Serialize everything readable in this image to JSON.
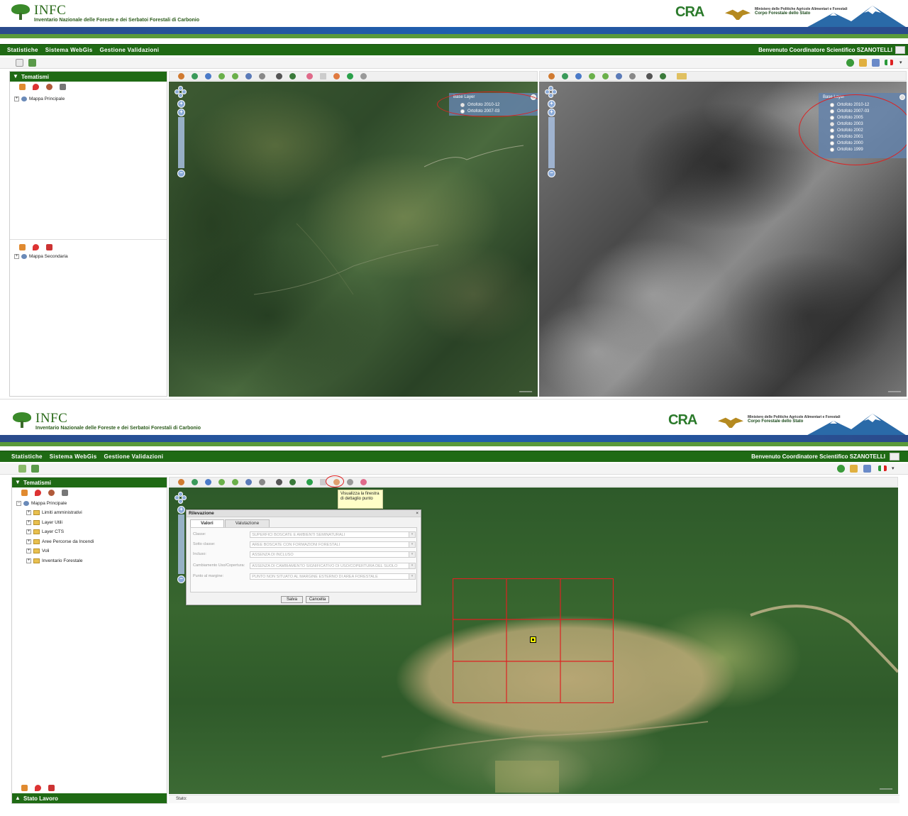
{
  "app": {
    "logo_title": "INFC",
    "logo_subtitle": "Inventario Nazionale delle Foreste e dei Serbatoi Forestali di Carbonio",
    "cra_logo": "CRA",
    "ministry_line": "Ministero delle Politiche Agricole Alimentari e Forestali",
    "corpo_line": "Corpo Forestale dello Stato"
  },
  "menu": {
    "items": [
      "Statistiche",
      "Sistema WebGis",
      "Gestione Validazioni"
    ],
    "welcome": "Benvenuto Coordinatore Scientifico SZANOTELLI"
  },
  "screen1": {
    "panel_title": "Tematismi",
    "main_map_label": "Mappa Principale",
    "secondary_map_label": "Mappa Secondaria",
    "left_map": {
      "base_layer_title": "Base Layer",
      "options": [
        {
          "label": "Ortofoto 2010-12",
          "selected": true
        },
        {
          "label": "Ortofoto 2007-03",
          "selected": false
        }
      ]
    },
    "right_map": {
      "base_layer_title": "Base Layer",
      "options": [
        {
          "label": "Ortofoto 2010-12",
          "selected": false
        },
        {
          "label": "Ortofoto 2007-03",
          "selected": false
        },
        {
          "label": "Ortofoto 2005",
          "selected": false
        },
        {
          "label": "Ortofoto 2003",
          "selected": true
        },
        {
          "label": "Ortofoto 2002",
          "selected": false
        },
        {
          "label": "Ortofoto 2001",
          "selected": false
        },
        {
          "label": "Ortofoto 2000",
          "selected": false
        },
        {
          "label": "Ortofoto 1999",
          "selected": false
        }
      ]
    }
  },
  "screen2": {
    "panel_title": "Tematismi",
    "main_map_label": "Mappa Principale",
    "tree_items": [
      "Limiti amministrativi",
      "Layer Utili",
      "Layer CTS",
      "Aree Percorse da Incendi",
      "Voli",
      "Inventario Forestale"
    ],
    "work_state": "Stato Lavoro",
    "status_label": "Stato:",
    "tooltip": "Visualizza la finestra di dettaglio punto",
    "dialog": {
      "title": "Rilevazione",
      "close": "×",
      "tabs": [
        "Valori",
        "Valutazione"
      ],
      "fields": [
        {
          "label": "Classe:",
          "value": "SUPERFICI BOSCATE E AMBIENTI SEMINATURALI"
        },
        {
          "label": "Sotto classe:",
          "value": "AREE BOSCATE CON FORMAZIONI FORESTALI"
        },
        {
          "label": "Incluso:",
          "value": "ASSENZA DI INCLUSO"
        },
        {
          "label": "Cambiamento Uso/Copertura:",
          "value": "ASSENZA DI CAMBIAMENTO SIGNIFICATIVO DI USO/COPERTURA DEL SUOLO"
        },
        {
          "label": "Punto al margine:",
          "value": "PUNTO NON SITUATO AL MARGINE ESTERNO DI AREA FORESTALE"
        }
      ],
      "save": "Salva",
      "cancel": "Cancella"
    }
  },
  "colors": {
    "green_dark": "#1f6a14",
    "blue_band": "#1f5faf",
    "accent_red": "#dd2222"
  }
}
